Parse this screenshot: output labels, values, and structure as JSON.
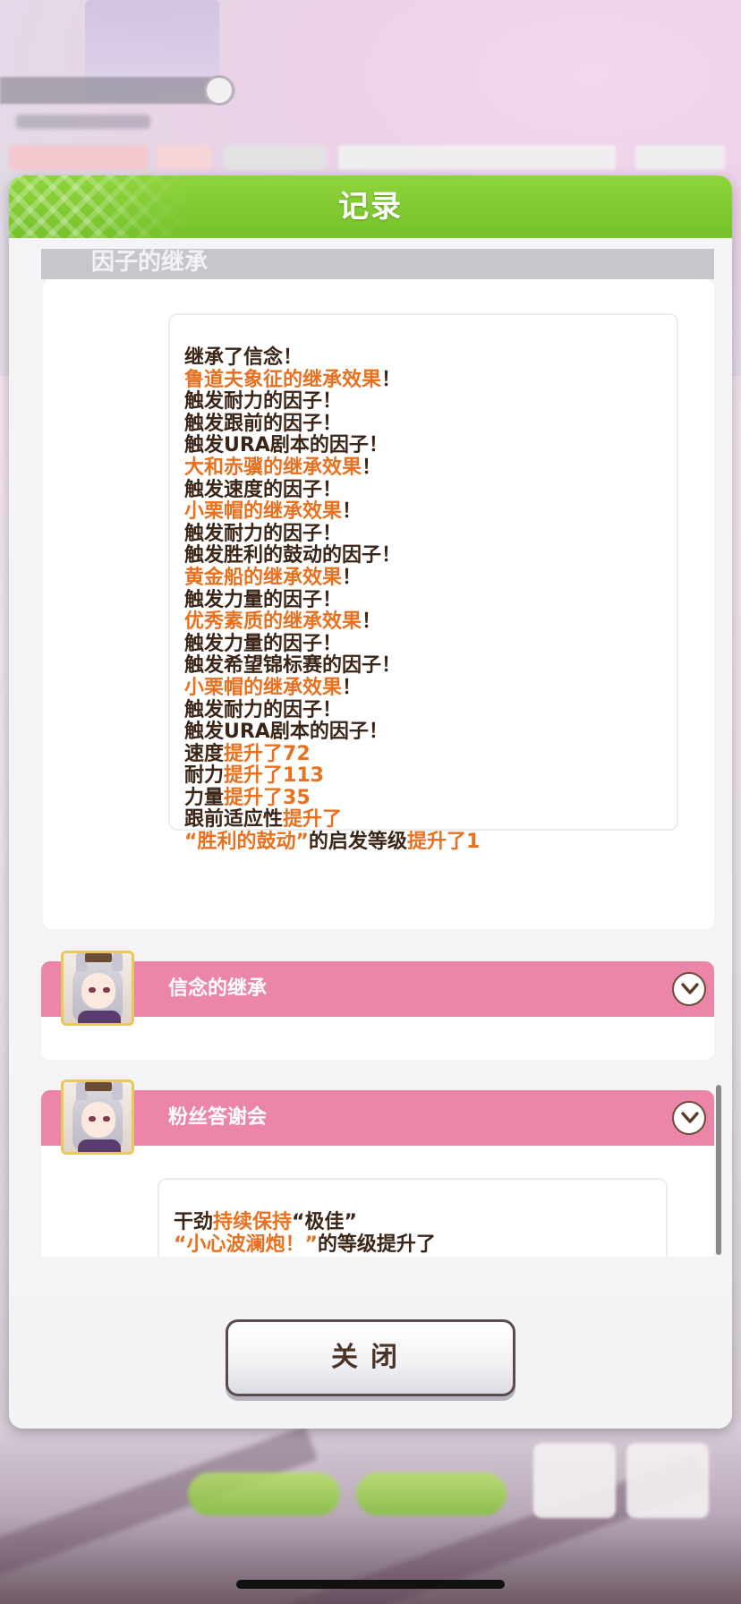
{
  "dialog": {
    "title": "记录",
    "section_header": "因子的继承",
    "close_label": "关闭"
  },
  "inheritance_log": [
    {
      "parts": [
        {
          "text": "继承了信念！",
          "style": "dark"
        }
      ]
    },
    {
      "parts": [
        {
          "text": "鲁道夫象征的继承效果",
          "style": "orange"
        },
        {
          "text": "！",
          "style": "dark"
        }
      ]
    },
    {
      "parts": [
        {
          "text": "触发耐力的因子！",
          "style": "dark"
        }
      ]
    },
    {
      "parts": [
        {
          "text": "触发跟前的因子！",
          "style": "dark"
        }
      ]
    },
    {
      "parts": [
        {
          "text": "触发URA剧本的因子！",
          "style": "dark"
        }
      ]
    },
    {
      "parts": [
        {
          "text": "大和赤骥的继承效果",
          "style": "orange"
        },
        {
          "text": "！",
          "style": "dark"
        }
      ]
    },
    {
      "parts": [
        {
          "text": "触发速度的因子！",
          "style": "dark"
        }
      ]
    },
    {
      "parts": [
        {
          "text": "小栗帽的继承效果",
          "style": "orange"
        },
        {
          "text": "！",
          "style": "dark"
        }
      ]
    },
    {
      "parts": [
        {
          "text": "触发耐力的因子！",
          "style": "dark"
        }
      ]
    },
    {
      "parts": [
        {
          "text": "触发胜利的鼓动的因子！",
          "style": "dark"
        }
      ]
    },
    {
      "parts": [
        {
          "text": "黄金船的继承效果",
          "style": "orange"
        },
        {
          "text": "！",
          "style": "dark"
        }
      ]
    },
    {
      "parts": [
        {
          "text": "触发力量的因子！",
          "style": "dark"
        }
      ]
    },
    {
      "parts": [
        {
          "text": "优秀素质的继承效果",
          "style": "orange"
        },
        {
          "text": "！",
          "style": "dark"
        }
      ]
    },
    {
      "parts": [
        {
          "text": "触发力量的因子！",
          "style": "dark"
        }
      ]
    },
    {
      "parts": [
        {
          "text": "触发希望锦标赛的因子！",
          "style": "dark"
        }
      ]
    },
    {
      "parts": [
        {
          "text": "小栗帽的继承效果",
          "style": "orange"
        },
        {
          "text": "！",
          "style": "dark"
        }
      ]
    },
    {
      "parts": [
        {
          "text": "触发耐力的因子！",
          "style": "dark"
        }
      ]
    },
    {
      "parts": [
        {
          "text": "触发URA剧本的因子！",
          "style": "dark"
        }
      ]
    },
    {
      "parts": [
        {
          "text": "速度",
          "style": "dark"
        },
        {
          "text": "提升了72",
          "style": "orange"
        }
      ]
    },
    {
      "parts": [
        {
          "text": "耐力",
          "style": "dark"
        },
        {
          "text": "提升了113",
          "style": "orange"
        }
      ]
    },
    {
      "parts": [
        {
          "text": "力量",
          "style": "dark"
        },
        {
          "text": "提升了35",
          "style": "orange"
        }
      ]
    },
    {
      "parts": [
        {
          "text": "跟前适应性",
          "style": "dark"
        },
        {
          "text": "提升了",
          "style": "orange"
        }
      ]
    },
    {
      "parts": [
        {
          "text": "“胜利的鼓动”",
          "style": "orange"
        },
        {
          "text": "的启发等级",
          "style": "dark"
        },
        {
          "text": "提升了1",
          "style": "orange"
        }
      ]
    }
  ],
  "events": [
    {
      "title": "信念的继承"
    },
    {
      "title": "粉丝答谢会"
    }
  ],
  "fan_event_log": [
    {
      "parts": [
        {
          "text": "干劲",
          "style": "dark"
        },
        {
          "text": "持续保持",
          "style": "orange"
        },
        {
          "text": "“极佳”",
          "style": "dark"
        }
      ]
    },
    {
      "parts": [
        {
          "text": "“小心波澜炮！”",
          "style": "orange"
        },
        {
          "text": "的等级提升了",
          "style": "dark"
        }
      ]
    }
  ],
  "colors": {
    "header_green": "#7cc832",
    "event_pink": "#ec86a8",
    "text_dark": "#3b2517",
    "text_orange": "#e8701e"
  }
}
